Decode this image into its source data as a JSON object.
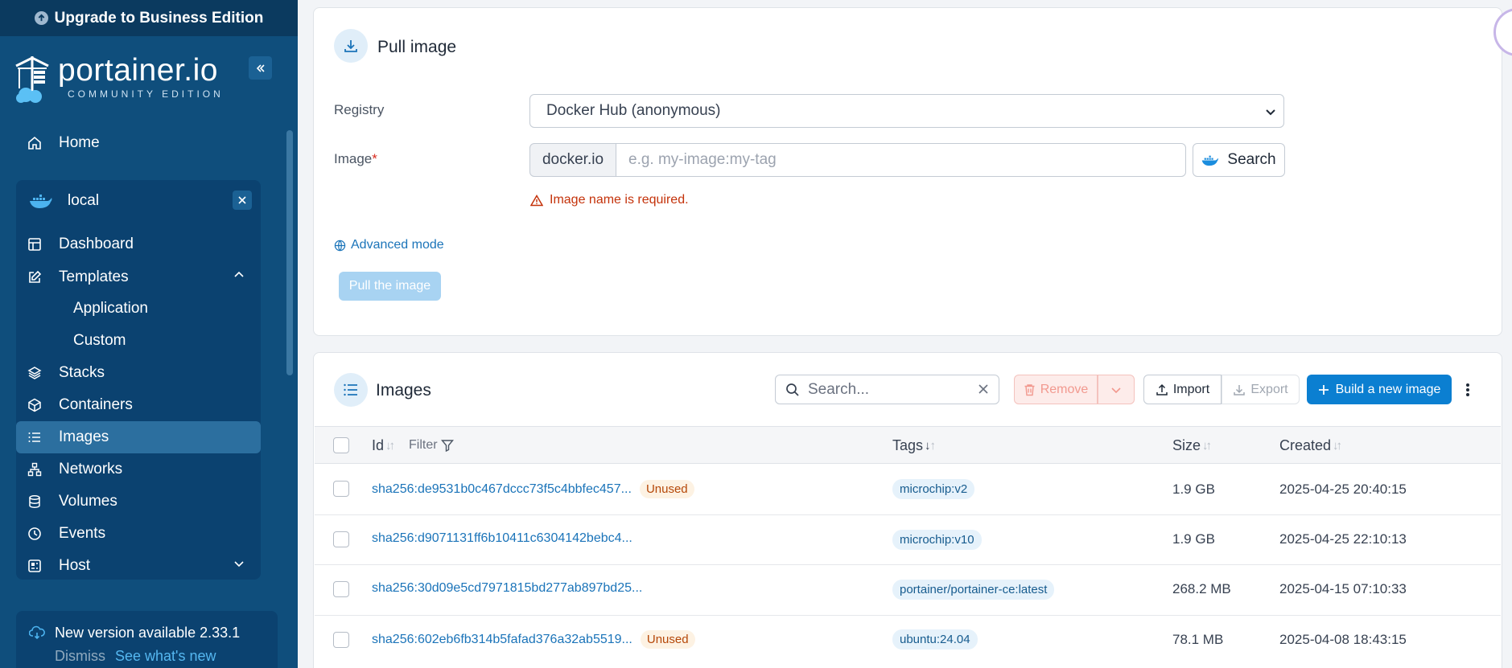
{
  "sidebar": {
    "upgrade_label": "Upgrade to Business Edition",
    "logo_brand": "portainer.io",
    "logo_edition": "COMMUNITY EDITION",
    "home_label": "Home",
    "environment_name": "local",
    "items": [
      {
        "label": "Dashboard",
        "icon": "dashboard-icon"
      },
      {
        "label": "Templates",
        "icon": "templates-icon"
      },
      {
        "label": "Stacks",
        "icon": "stacks-icon"
      },
      {
        "label": "Containers",
        "icon": "containers-icon"
      },
      {
        "label": "Images",
        "icon": "images-icon"
      },
      {
        "label": "Networks",
        "icon": "networks-icon"
      },
      {
        "label": "Volumes",
        "icon": "volumes-icon"
      },
      {
        "label": "Events",
        "icon": "events-icon"
      },
      {
        "label": "Host",
        "icon": "host-icon"
      }
    ],
    "template_sub": [
      "Application",
      "Custom"
    ],
    "update": {
      "title": "New version available 2.33.1",
      "dismiss": "Dismiss",
      "see_new": "See what's new"
    }
  },
  "pull": {
    "title": "Pull image",
    "registry_label": "Registry",
    "registry_value": "Docker Hub (anonymous)",
    "image_label": "Image",
    "required_mark": "*",
    "registry_prefix": "docker.io",
    "image_placeholder": "e.g. my-image:my-tag",
    "image_value": "",
    "search_label": "Search",
    "error": "Image name is required.",
    "advanced_mode": "Advanced mode",
    "pull_button": "Pull the image"
  },
  "images": {
    "title": "Images",
    "search_placeholder": "Search...",
    "remove_label": "Remove",
    "import_label": "Import",
    "export_label": "Export",
    "build_label": "Build a new image",
    "columns": {
      "id": "Id",
      "filter": "Filter",
      "tags": "Tags",
      "size": "Size",
      "created": "Created"
    },
    "rows": [
      {
        "id": "sha256:de9531b0c467dccc73f5c4bbfec457...",
        "badge": "Unused",
        "tag": "microchip:v2",
        "size": "1.9 GB",
        "created": "2025-04-25 20:40:15"
      },
      {
        "id": "sha256:d9071131ff6b10411c6304142bebc4...",
        "badge": "",
        "tag": "microchip:v10",
        "size": "1.9 GB",
        "created": "2025-04-25 22:10:13"
      },
      {
        "id": "sha256:30d09e5cd7971815bd277ab897bd25...",
        "badge": "",
        "tag": "portainer/portainer-ce:latest",
        "size": "268.2 MB",
        "created": "2025-04-15 07:10:33"
      },
      {
        "id": "sha256:602eb6fb314b5fafad376a32ab5519...",
        "badge": "Unused",
        "tag": "ubuntu:24.04",
        "size": "78.1 MB",
        "created": "2025-04-08 18:43:15"
      }
    ]
  },
  "colors": {
    "sidebar": "#0f4e7c",
    "accent": "#0b7fd1",
    "error": "#c4320a"
  }
}
